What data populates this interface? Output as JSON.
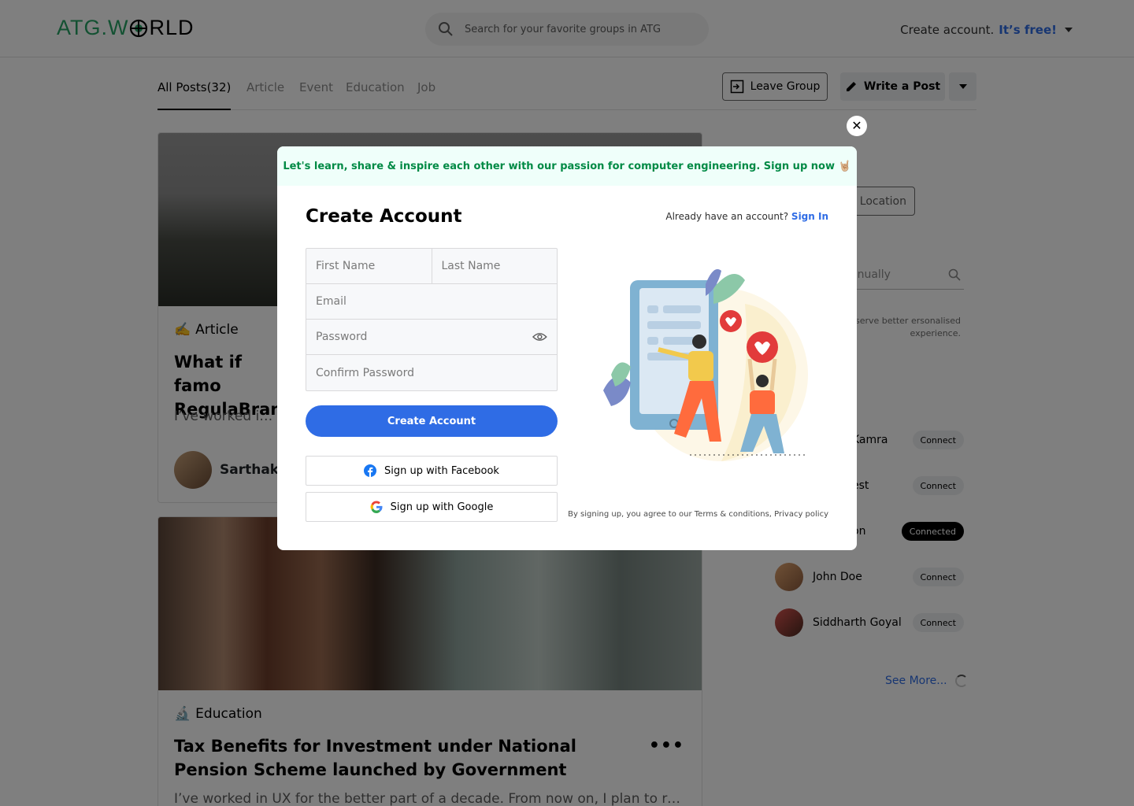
{
  "header": {
    "logo": {
      "prefix": "ATG.W",
      "suffix": "RLD"
    },
    "search_placeholder": "Search for your favorite groups in ATG",
    "create_account": "Create account.",
    "create_account_free": "It’s free!"
  },
  "tabs": [
    {
      "label": "All Posts(32)"
    },
    {
      "label": "Article"
    },
    {
      "label": "Event"
    },
    {
      "label": "Education"
    },
    {
      "label": "Job"
    }
  ],
  "actions": {
    "leave_group": "Leave Group",
    "write_post": "Write a Post"
  },
  "posts": [
    {
      "tag_emoji": "✍️",
      "tag": "Article",
      "title": "What if famo RegulaBrand",
      "description": "I’ve worked in U",
      "author": "Sarthak I"
    },
    {
      "tag_emoji": "🔬",
      "tag": "Education",
      "title": "Tax Benefits for Investment under National Pension Scheme launched by Government",
      "description": "I’ve worked in UX for the better part of a decade. From now on, I plan to rei...",
      "more": "•••"
    }
  ],
  "sidebar": {
    "location_btn": "t Location",
    "location_input": "anually",
    "location_note": "ill help us serve better ersonalised experience.",
    "people": [
      {
        "name": "Kamra",
        "action": "Connect",
        "connected": false
      },
      {
        "name": "est",
        "action": "Connect",
        "connected": false
      },
      {
        "name": "on",
        "action": "Connected",
        "connected": true
      },
      {
        "name": "John Doe",
        "action": "Connect",
        "connected": false
      },
      {
        "name": "Siddharth Goyal",
        "action": "Connect",
        "connected": false
      }
    ],
    "see_more": "See More..."
  },
  "modal": {
    "close": "✕",
    "banner": "Let's learn, share & inspire each other with our passion for computer engineering. Sign up now 🤘🏼",
    "title": "Create Account",
    "already": "Already have an account?",
    "sign_in": "Sign In",
    "first_name_placeholder": "First Name",
    "last_name_placeholder": "Last Name",
    "email_placeholder": "Email",
    "password_placeholder": "Password",
    "confirm_password_placeholder": "Confirm Password",
    "create_button": "Create Account",
    "facebook_button": "Sign up with Facebook",
    "google_button": "Sign up with Google",
    "terms": "By signing up, you agree to our Terms & conditions, Privacy policy"
  },
  "colors": {
    "accent": "#2f6ce5",
    "brand_green": "#27a365",
    "banner_bg": "#effffa",
    "banner_text": "#008a45"
  }
}
